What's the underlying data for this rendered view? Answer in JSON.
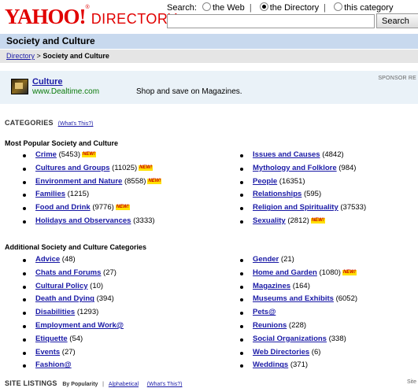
{
  "header": {
    "logo_text": "YAHOO!",
    "logo_reg": "®",
    "logo_directory": "DIRECTORY",
    "search_label": "Search:",
    "search_options": [
      {
        "label": "the Web",
        "selected": false
      },
      {
        "label": "the Directory",
        "selected": true
      },
      {
        "label": "this category",
        "selected": false
      }
    ],
    "search_value": "",
    "search_button": "Search"
  },
  "title_bar": "Society and Culture",
  "breadcrumb": {
    "root": "Directory",
    "separator": ">",
    "current": "Society and Culture"
  },
  "sponsor": {
    "label": "SPONSOR RE",
    "title": "Culture",
    "url": "www.Dealtime.com",
    "description": "Shop and save on Magazines."
  },
  "categories_header": {
    "label": "CATEGORIES",
    "whats_this": "(What's This?)"
  },
  "new_badge": "NEW!",
  "popular": {
    "heading": "Most Popular Society and Culture",
    "left": [
      {
        "name": "Crime",
        "count": "(5453)",
        "is_new": true
      },
      {
        "name": "Cultures and Groups",
        "count": "(11025)",
        "is_new": true
      },
      {
        "name": "Environment and Nature",
        "count": "(8558)",
        "is_new": true
      },
      {
        "name": "Families",
        "count": "(1215)",
        "is_new": false
      },
      {
        "name": "Food and Drink",
        "count": "(9776)",
        "is_new": true
      },
      {
        "name": "Holidays and Observances",
        "count": "(3333)",
        "is_new": false
      }
    ],
    "right": [
      {
        "name": "Issues and Causes",
        "count": "(4842)",
        "is_new": false
      },
      {
        "name": "Mythology and Folklore",
        "count": "(984)",
        "is_new": false
      },
      {
        "name": "People",
        "count": "(16351)",
        "is_new": false
      },
      {
        "name": "Relationships",
        "count": "(595)",
        "is_new": false
      },
      {
        "name": "Religion and Spirituality",
        "count": "(37533)",
        "is_new": false
      },
      {
        "name": "Sexuality",
        "count": "(2812)",
        "is_new": true
      }
    ]
  },
  "additional": {
    "heading": "Additional Society and Culture Categories",
    "left": [
      {
        "name": "Advice",
        "count": "(48)",
        "is_new": false
      },
      {
        "name": "Chats and Forums",
        "count": "(27)",
        "is_new": false
      },
      {
        "name": "Cultural Policy",
        "count": "(10)",
        "is_new": false
      },
      {
        "name": "Death and Dying",
        "count": "(394)",
        "is_new": false
      },
      {
        "name": "Disabilities",
        "count": "(1293)",
        "is_new": false
      },
      {
        "name": "Employment and Work@",
        "count": "",
        "is_new": false
      },
      {
        "name": "Etiquette",
        "count": "(54)",
        "is_new": false
      },
      {
        "name": "Events",
        "count": "(27)",
        "is_new": false
      },
      {
        "name": "Fashion@",
        "count": "",
        "is_new": false
      }
    ],
    "right": [
      {
        "name": "Gender",
        "count": "(21)",
        "is_new": false
      },
      {
        "name": "Home and Garden",
        "count": "(1080)",
        "is_new": true
      },
      {
        "name": "Magazines",
        "count": "(164)",
        "is_new": false
      },
      {
        "name": "Museums and Exhibits",
        "count": "(6052)",
        "is_new": false
      },
      {
        "name": "Pets@",
        "count": "",
        "is_new": false
      },
      {
        "name": "Reunions",
        "count": "(228)",
        "is_new": false
      },
      {
        "name": "Social Organizations",
        "count": "(338)",
        "is_new": false
      },
      {
        "name": "Web Directories",
        "count": "(6)",
        "is_new": false
      },
      {
        "name": "Weddings",
        "count": "(371)",
        "is_new": false
      }
    ]
  },
  "site_listings": {
    "label": "SITE LISTINGS",
    "by_popularity": "By Popularity",
    "alphabetical": "Alphabetical",
    "whats_this": "(What's This?)",
    "right_text": "Site"
  }
}
